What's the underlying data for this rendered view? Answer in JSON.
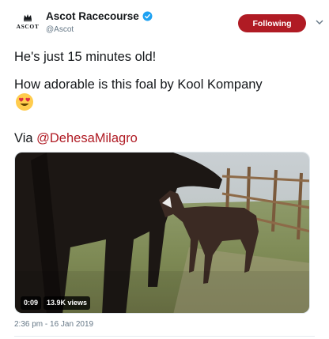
{
  "account": {
    "display_name": "Ascot Racecourse",
    "handle": "@Ascot",
    "avatar_label": "ASCOT",
    "verified": true
  },
  "follow_button": {
    "label": "Following",
    "color": "#b01b24"
  },
  "tweet": {
    "line1": "He's just 15 minutes old!",
    "line2": "How adorable is this foal by Kool Kompany",
    "emoji": "heart-eyes-emoji",
    "via_prefix": "Via ",
    "mention": "@DehesaMilagro",
    "mention_color": "#b01b24"
  },
  "video": {
    "duration": "0:09",
    "views": "13.9K views"
  },
  "timestamp": "2:36 pm - 16 Jan 2019"
}
